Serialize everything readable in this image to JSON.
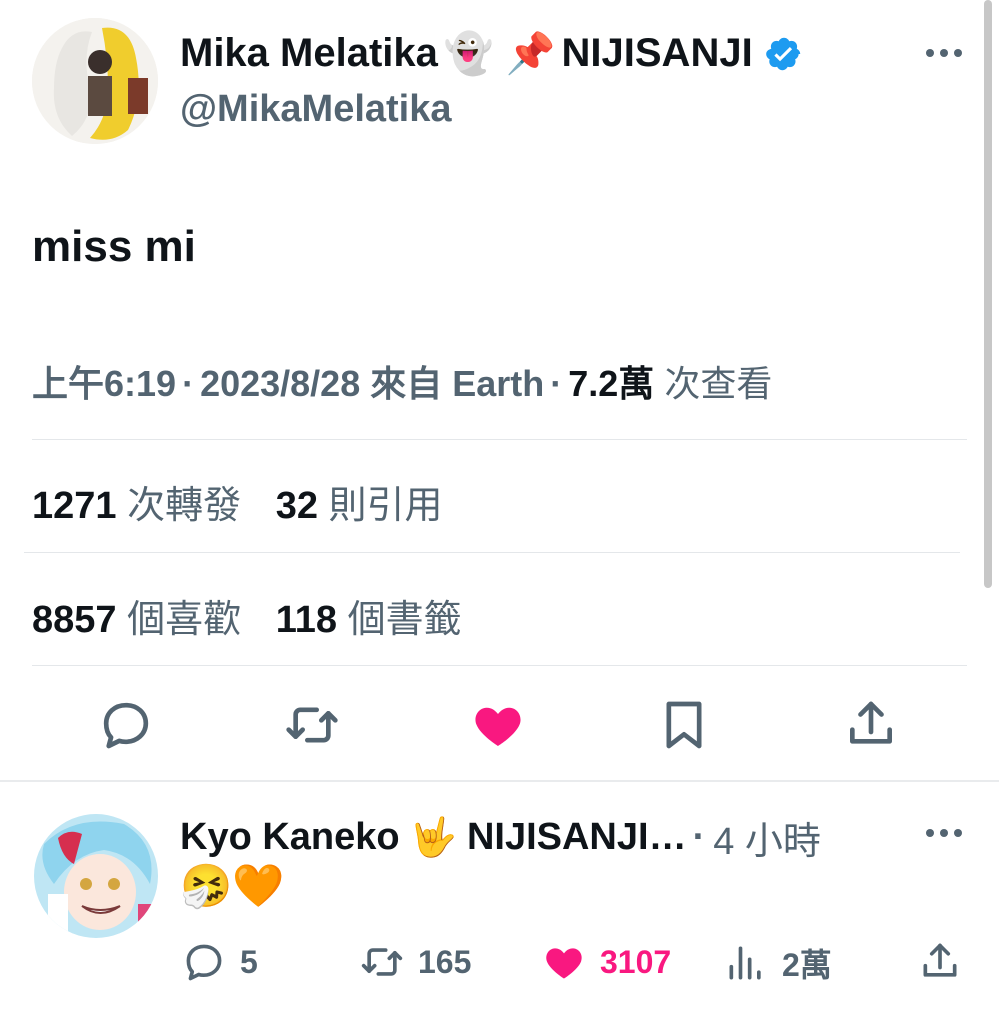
{
  "tweet": {
    "display_name": "Mika Melatika",
    "name_emojis": [
      "👻",
      "📌"
    ],
    "org": "NIJISANJI",
    "handle": "@MikaMelatika",
    "text": "miss mi",
    "time": "上午6:19",
    "date": "2023/8/28",
    "source": "來自 Earth",
    "views_count": "7.2萬",
    "views_label": "次查看",
    "stats": {
      "retweets": {
        "count": "1271",
        "label": "次轉發"
      },
      "quotes": {
        "count": "32",
        "label": "則引用"
      },
      "likes": {
        "count": "8857",
        "label": "個喜歡"
      },
      "bookmarks": {
        "count": "118",
        "label": "個書籤"
      }
    },
    "liked": true
  },
  "reply": {
    "display_name": "Kyo Kaneko",
    "name_emoji": "🤟",
    "org_truncated": "NIJISANJI…",
    "separator": "·",
    "time": "4 小時",
    "text": "🤧🧡",
    "actions": {
      "replies": "5",
      "retweets": "165",
      "likes": "3107",
      "views": "2萬"
    }
  },
  "icons": [
    "more-icon",
    "verified-icon",
    "reply-icon",
    "retweet-icon",
    "like-icon",
    "bookmark-icon",
    "share-icon",
    "views-icon"
  ],
  "colors": {
    "text": "#0f1419",
    "secondary": "#536471",
    "like": "#f91880",
    "verified": "#1d9bf0",
    "divider": "#e4e7ea"
  }
}
